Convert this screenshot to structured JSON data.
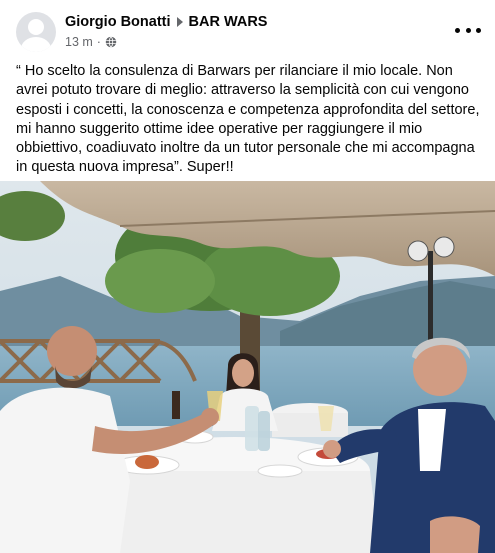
{
  "post": {
    "author": "Giorgio Bonatti",
    "page": "BAR WARS",
    "time": "13 m",
    "separator": "·",
    "privacy_icon": "globe-icon",
    "more_icon": "more-options-icon",
    "text": "“ Ho scelto la consulenza di Barwars per rilanciare il mio locale. Non avrei potuto trovare di meglio: attraverso la semplicità con cui vengono esposti i concetti, la conoscenza e competenza approfondita del settore, mi hanno suggerito ottime idee operative per raggiungere il mio obbiettivo, coadiuvato inoltre da un tutor personale che mi accompagna in questa nuova impresa”. Super!!"
  },
  "colors": {
    "secondary_text": "#65676b",
    "primary_text": "#050505"
  }
}
